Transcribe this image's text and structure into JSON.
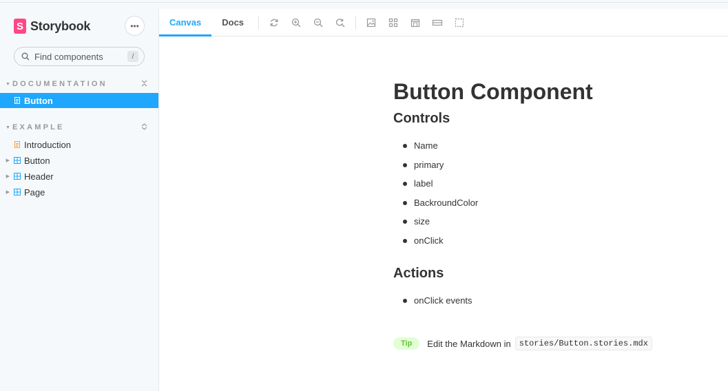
{
  "brand": {
    "name": "Storybook",
    "logo_letter": "S",
    "color": "#ff4785"
  },
  "sidebar": {
    "menu_icon": "ellipsis-icon",
    "search": {
      "placeholder": "Find components",
      "shortcut": "/"
    },
    "sections": [
      {
        "label": "DOCUMENTATION",
        "control_icon": "collapse-all-icon",
        "items": [
          {
            "label": "Button",
            "icon": "document-icon",
            "active": true
          }
        ]
      },
      {
        "label": "EXAMPLE",
        "control_icon": "expand-all-icon",
        "items": [
          {
            "label": "Introduction",
            "icon": "document-icon",
            "active": false
          },
          {
            "label": "Button",
            "icon": "component-icon",
            "active": false
          },
          {
            "label": "Header",
            "icon": "component-icon",
            "active": false
          },
          {
            "label": "Page",
            "icon": "component-icon",
            "active": false
          }
        ]
      }
    ]
  },
  "toolbar": {
    "tabs": [
      {
        "label": "Canvas",
        "active": true
      },
      {
        "label": "Docs",
        "active": false
      }
    ],
    "icons": [
      "refresh-icon",
      "zoom-in-icon",
      "zoom-out-icon",
      "reset-zoom-icon",
      "background-icon",
      "grid-icon",
      "viewport-icon",
      "measure-icon",
      "outline-icon"
    ]
  },
  "doc": {
    "title": "Button Component",
    "controls_heading": "Controls",
    "controls": [
      "Name",
      "primary",
      "label",
      "BackroundColor",
      "size",
      "onClick"
    ],
    "actions_heading": "Actions",
    "actions": [
      "onClick events"
    ],
    "tip": {
      "badge": "Tip",
      "text": "Edit the Markdown in",
      "code": "stories/Button.stories.mdx"
    }
  },
  "colors": {
    "accent": "#1ea7fd",
    "tip_bg": "#e1ffd4",
    "tip_fg": "#66bf3c"
  }
}
